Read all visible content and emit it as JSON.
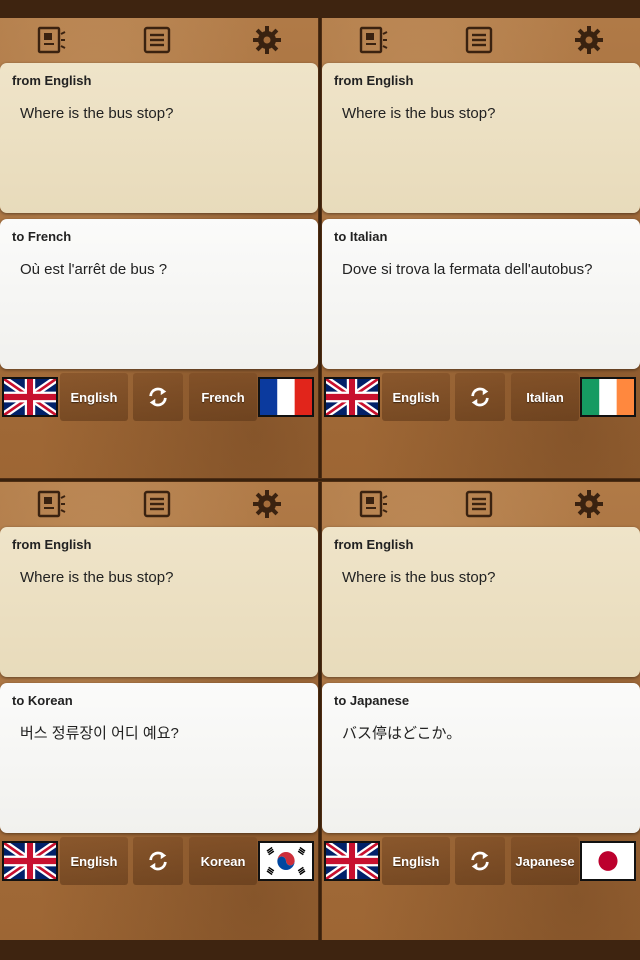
{
  "panels": [
    {
      "from_label": "from English",
      "from_text": "Where is the bus stop?",
      "to_label": "to French",
      "to_text": "Où est l'arrêt de bus ?",
      "source_lang": "English",
      "target_lang": "French",
      "target_flag": "france-flag"
    },
    {
      "from_label": "from English",
      "from_text": "Where is the bus stop?",
      "to_label": "to Italian",
      "to_text": "Dove si trova la fermata dell'autobus?",
      "source_lang": "English",
      "target_lang": "Italian",
      "target_flag": "ireland-flag"
    },
    {
      "from_label": "from English",
      "from_text": "Where is the bus stop?",
      "to_label": "to Korean",
      "to_text": "버스 정류장이 어디 예요?",
      "source_lang": "English",
      "target_lang": "Korean",
      "target_flag": "south-korea-flag"
    },
    {
      "from_label": "from English",
      "from_text": "Where is the bus stop?",
      "to_label": "to Japanese",
      "to_text": "バス停はどこか。",
      "source_lang": "English",
      "target_lang": "Japanese",
      "target_flag": "japan-flag"
    }
  ],
  "icons": {
    "toolbar": [
      "contact-card-icon",
      "list-icon",
      "gear-icon"
    ],
    "swap": "swap-icon",
    "source_flag": "uk-flag"
  },
  "colors": {
    "wood": "#a56d3b",
    "wood_dark": "#4a2c14",
    "from_card": "#ece0c3",
    "to_card": "#f7f7f5",
    "icon": "#3a2210"
  }
}
